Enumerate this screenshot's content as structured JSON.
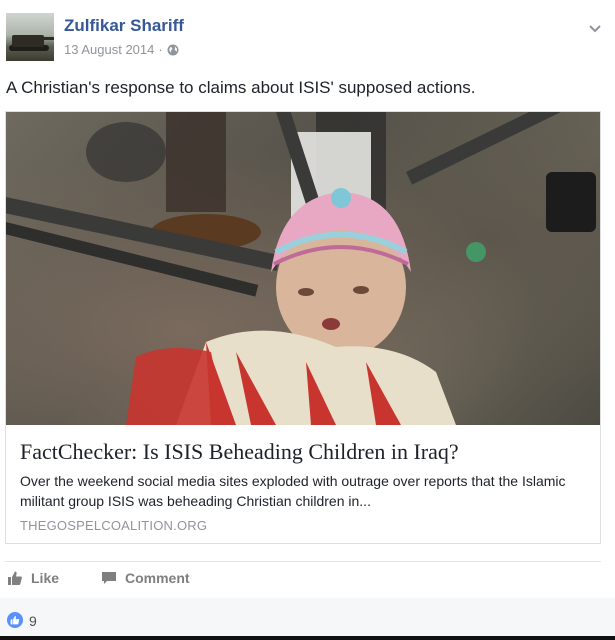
{
  "post": {
    "author": "Zulfikar Shariff",
    "date": "13 August 2014",
    "meta_separator": "·",
    "status_text": "A Christian's response to claims about ISIS' supposed actions."
  },
  "link_card": {
    "title": "FactChecker: Is ISIS Beheading Children in Iraq?",
    "description": "Over the weekend social media sites exploded with outrage over reports that the Islamic militant group ISIS was beheading Christian children in...",
    "domain": "THEGOSPELCOALITION.ORG"
  },
  "actions": {
    "like_label": "Like",
    "comment_label": "Comment"
  },
  "reactions": {
    "like_count": "9"
  },
  "colors": {
    "author_link": "#365899",
    "meta_gray": "#90949c",
    "like_badge": "#5890ff",
    "action_gray": "#7f7f7f"
  },
  "icons": [
    "globe-icon",
    "chevron-down-icon",
    "thumbs-up-icon",
    "comment-icon",
    "like-reaction-icon"
  ]
}
